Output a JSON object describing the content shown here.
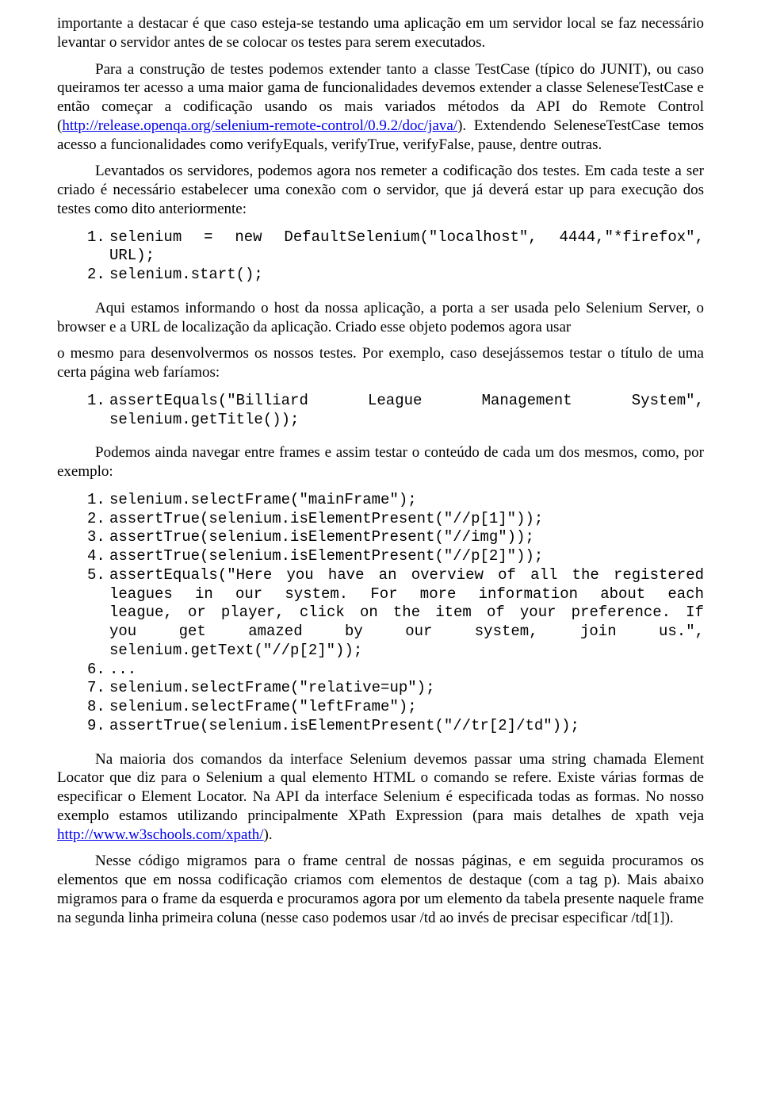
{
  "paras": {
    "p1_a": "importante a destacar é que caso esteja-se testando uma aplicação em um servidor local se faz necessário levantar o servidor antes de se colocar os testes para serem executados.",
    "p2_a": "Para a construção de testes podemos extender tanto a classe TestCase (típico do JUNIT), ou caso queiramos ter acesso a uma maior gama de funcionalidades devemos extender a classe SeleneseTestCase e então começar a codificação usando os mais variados métodos da API do Remote Control (",
    "p2_link": "http://release.openqa.org/selenium-remote-control/0.9.2/doc/java/",
    "p2_b": "). Extendendo SeleneseTestCase temos acesso a funcionalidades como verifyEquals, verifyTrue, verifyFalse, pause, dentre outras.",
    "p3": "Levantados os servidores, podemos agora nos remeter a codificação dos testes. Em cada teste a ser criado é necessário estabelecer uma conexão com o servidor, que já deverá estar up para execução dos testes como dito anteriormente:",
    "p4": "Aqui estamos informando o host da nossa aplicação, a porta a ser usada pelo Selenium Server, o browser e a URL de localização da aplicação. Criado esse objeto podemos agora usar",
    "p5": "o mesmo para desenvolvermos os nossos testes. Por exemplo, caso desejássemos testar o título de uma certa página web faríamos:",
    "p6": "Podemos ainda navegar entre frames e assim testar o conteúdo de cada um dos mesmos, como, por exemplo:",
    "p7_a": "Na maioria dos comandos da interface Selenium devemos passar uma string chamada Element Locator que diz para o Selenium a qual elemento HTML o comando se refere. Existe várias formas de especificar o Element Locator. Na API da interface Selenium é especificada todas as formas. No nosso exemplo estamos utilizando principalmente XPath Expression (para mais detalhes de xpath veja ",
    "p7_link": "http://www.w3schools.com/xpath/",
    "p7_b": ").",
    "p8": "Nesse código migramos para o frame central de nossas páginas, e em seguida procuramos os elementos que em nossa codificação criamos com elementos de destaque (com a tag p). Mais abaixo migramos para o frame da esquerda e procuramos agora por um elemento da tabela presente naquele frame na segunda linha primeira coluna (nesse caso podemos usar /td ao invés de precisar especificar /td[1])."
  },
  "code1": {
    "l1a": "selenium  =  new  DefaultSelenium(\"localhost\",  4444,\"*firefox\",",
    "l1b": "URL);",
    "l2": "selenium.start();"
  },
  "code2": {
    "l1a": "assertEquals(\"Billiard      League      Management      System\",",
    "l1b": "selenium.getTitle());"
  },
  "code3": {
    "l1": "selenium.selectFrame(\"mainFrame\");",
    "l2": "assertTrue(selenium.isElementPresent(\"//p[1]\"));",
    "l3": "assertTrue(selenium.isElementPresent(\"//img\"));",
    "l4": "assertTrue(selenium.isElementPresent(\"//p[2]\"));",
    "l5a": "assertEquals(\"Here you have an overview of all the registered",
    "l5b": "leagues  in  our  system.  For  more  information  about  each",
    "l5c": "league,  or  player,  click  on  the  item  of  your  preference.  If",
    "l5d": "you    get    amazed    by    our    system,    join    us.\",",
    "l5e": "selenium.getText(\"//p[2]\"));",
    "l6": "...",
    "l7": "selenium.selectFrame(\"relative=up\");",
    "l8": "selenium.selectFrame(\"leftFrame\");",
    "l9": "assertTrue(selenium.isElementPresent(\"//tr[2]/td\"));"
  },
  "nums": {
    "n1": "1.",
    "n2": "2.",
    "n3": "3.",
    "n4": "4.",
    "n5": "5.",
    "n6": "6.",
    "n7": "7.",
    "n8": "8.",
    "n9": "9."
  }
}
